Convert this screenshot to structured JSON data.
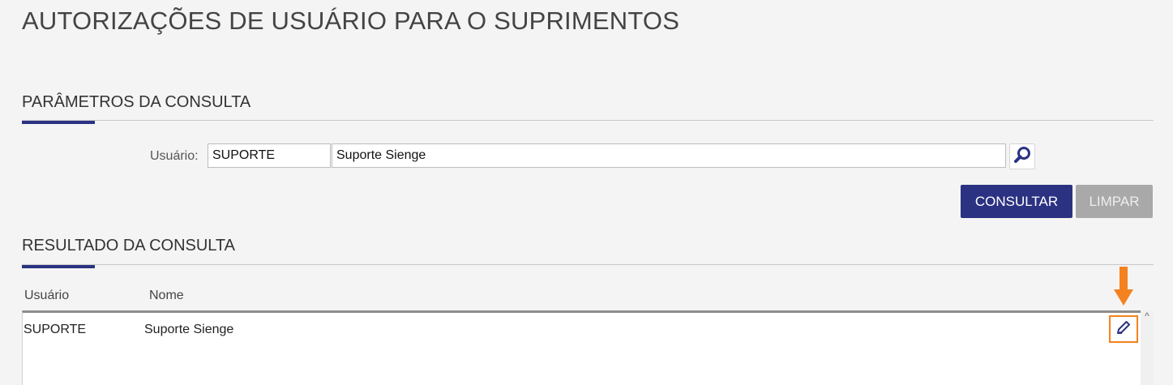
{
  "page": {
    "title": "AUTORIZAÇÕES DE USUÁRIO PARA O SUPRIMENTOS"
  },
  "params": {
    "section_title": "PARÂMETROS DA CONSULTA",
    "user_label": "Usuário:",
    "user_code": "SUPORTE",
    "user_name": "Suporte Sienge",
    "search_icon": "magnifier-icon"
  },
  "actions": {
    "consultar_label": "CONSULTAR",
    "limpar_label": "LIMPAR"
  },
  "results": {
    "section_title": "RESULTADO DA CONSULTA",
    "columns": [
      "Usuário",
      "Nome"
    ],
    "rows": [
      {
        "usuario": "SUPORTE",
        "nome": "Suporte Sienge"
      }
    ],
    "edit_icon": "pencil-icon"
  },
  "colors": {
    "primary": "#2b3282",
    "disabled": "#a9a9a9",
    "highlight": "#f58220"
  }
}
